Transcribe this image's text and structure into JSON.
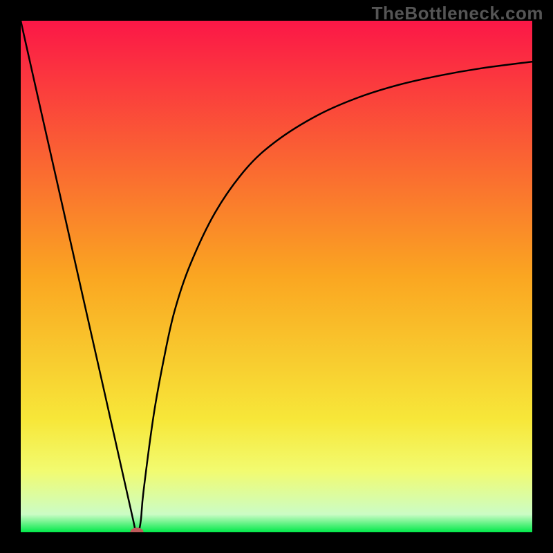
{
  "watermark": "TheBottleneck.com",
  "chart_data": {
    "type": "line",
    "title": "",
    "xlabel": "",
    "ylabel": "",
    "xlim": [
      0,
      100
    ],
    "ylim": [
      0,
      100
    ],
    "grid": false,
    "legend": false,
    "background_gradient": {
      "stops": [
        {
          "offset": 0.0,
          "color": "#fb1747"
        },
        {
          "offset": 0.5,
          "color": "#faa621"
        },
        {
          "offset": 0.78,
          "color": "#f7e739"
        },
        {
          "offset": 0.88,
          "color": "#f2fb70"
        },
        {
          "offset": 0.965,
          "color": "#cbfcc5"
        },
        {
          "offset": 1.0,
          "color": "#01e94a"
        }
      ]
    },
    "curve": {
      "x": [
        0.0,
        4.0,
        8.0,
        12.0,
        16.0,
        18.0,
        20.0,
        22.0,
        22.5,
        23.0,
        23.5,
        24.0,
        26.0,
        28.0,
        30.0,
        33.0,
        38.0,
        44.0,
        50.0,
        58.0,
        66.0,
        74.0,
        82.0,
        90.0,
        100.0
      ],
      "y": [
        100.0,
        82.2,
        64.5,
        46.7,
        29.0,
        20.1,
        11.2,
        2.3,
        0.0,
        0.0,
        2.5,
        8.0,
        23.0,
        34.0,
        43.0,
        52.0,
        62.5,
        71.0,
        76.5,
        81.5,
        85.0,
        87.5,
        89.3,
        90.7,
        92.0
      ]
    },
    "marker": {
      "x": 22.7,
      "y": 0.0,
      "rx": 1.3,
      "ry": 0.9,
      "color": "#c05b5b"
    }
  }
}
